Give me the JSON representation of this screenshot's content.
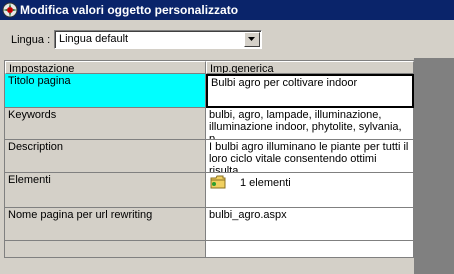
{
  "window": {
    "title": "Modifica valori oggetto personalizzato",
    "icon": "app-settings-icon"
  },
  "language": {
    "label": "Lingua :",
    "selected": "Lingua default"
  },
  "grid": {
    "headers": {
      "property": "Impostazione",
      "value": "Imp.generica"
    },
    "rows": [
      {
        "property": "Titolo pagina",
        "value": "Bulbi agro per coltivare indoor",
        "selected": true
      },
      {
        "property": "Keywords",
        "value": "bulbi, agro, lampade, illuminazione, illuminazione indoor, phytolite, sylvania, p..."
      },
      {
        "property": "Description",
        "value": "I bulbi agro illuminano le piante per tutti il loro ciclo vitale consentendo ottimi risulta..."
      },
      {
        "property": "Elementi",
        "value": "1 elementi",
        "icon": "folder-icon"
      },
      {
        "property": "Nome pagina per url rewriting",
        "value": "bulbi_agro.aspx"
      }
    ]
  },
  "colors": {
    "titlebar": "#0a246a",
    "selection": "#00ffff",
    "face": "#d4d0c8"
  }
}
